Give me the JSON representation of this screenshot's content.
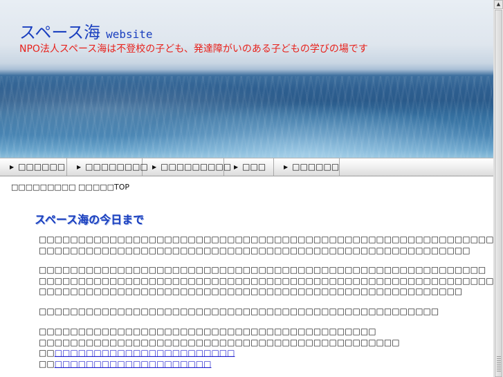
{
  "header": {
    "title_ja": "スペース海",
    "title_en": "website",
    "tagline": "NPO法人スペース海は不登校の子ども、発達障がいのある子どもの学びの場です"
  },
  "nav": {
    "items": [
      {
        "label": "□□□□□□"
      },
      {
        "label": "□□□□□□□□"
      },
      {
        "label": "□□□□□□□□□"
      },
      {
        "label": "□□□"
      },
      {
        "label": "□□□□□□"
      }
    ]
  },
  "breadcrumb": "□□□□□□□□□ □□□□□TOP",
  "main": {
    "title": "スペース海の今日まで",
    "paragraphs": [
      {
        "lines": [
          "□□□□□□□□□□□□□□□□□□□□□□□□□□□□□□□□□□□□□□□□□□□□□□□□□□□□□□□□□□",
          "□□□□□□□□□□□□□□□□□□□□□□□□□□□□□□□□□□□□□□□□□□□□□□□□□□□□□□□"
        ]
      },
      {
        "lines": [
          "□□□□□□□□□□□□□□□□□□□□□□□□□□□□□□□□□□□□□□□□□□□□□□□□□□□□□□□□□",
          "□□□□□□□□□□□□□□□□□□□□□□□□□□□□□□□□□□□□□□□□□□□□□□□□□□□□□□□□□□□",
          "□□□□□□□□□□□□□□□□□□□□□□□□□□□□□□□□□□□□□□□□□□□□□□□□□□□□□□"
        ]
      },
      {
        "lines": [
          "□□□□□□□□□□□□□□□□□□□□□□□□□□□□□□□□□□□□□□□□□□□□□□□□□□□"
        ]
      },
      {
        "lines": [
          "□□□□□□□□□□□□□□□□□□□□□□□□□□□□□□□□□□□□□□□□□□□",
          "□□□□□□□□□□□□□□□□□□□□□□□□□□□□□□□□□□□□□□□□□□□□□□"
        ]
      }
    ],
    "links": [
      {
        "prefix": "□□",
        "text": "□□□□□□□□□□□□□□□□□□□□□□□"
      },
      {
        "prefix": "□□",
        "text": "□□□□□□□□□□□□□□□□□□□□"
      }
    ]
  },
  "scrollbar": {
    "up_glyph": "▲"
  }
}
